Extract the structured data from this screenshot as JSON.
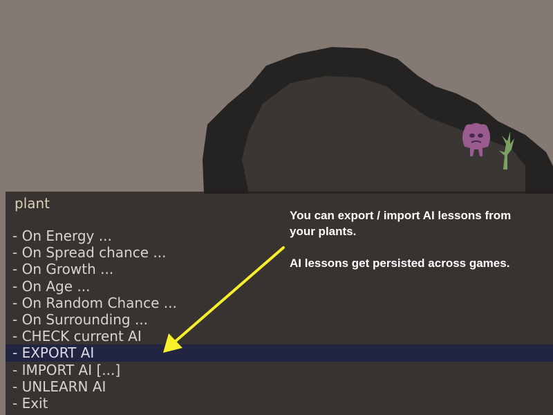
{
  "colors": {
    "background": "#857a73",
    "dark_mass": "#252321",
    "menu_panel": "#221f1d",
    "menu_text": "#d6d4cc",
    "menu_title": "#d8d1b4",
    "selection_highlight": "#222542",
    "arrow": "#f7f02a",
    "creature": "#9a5c90",
    "plant": "#7aa064"
  },
  "menu": {
    "title": "plant",
    "selected_index": 7,
    "items": [
      "- On Energy ...",
      "- On Spread chance ...",
      "- On Growth ...",
      "- On Age ...",
      "- On Random Chance ...",
      "- On Surrounding ...",
      "- CHECK current AI",
      "- EXPORT AI",
      "- IMPORT AI [...]",
      "- UNLEARN AI",
      "- Exit"
    ]
  },
  "callout": {
    "line1": "You can export / import AI lessons from your plants.",
    "line2": "AI lessons get persisted across games."
  },
  "scene": {
    "creature_icon": "purple-creature-icon",
    "plant_icon": "green-sprout-icon",
    "arrow_icon": "yellow-arrow-icon"
  }
}
